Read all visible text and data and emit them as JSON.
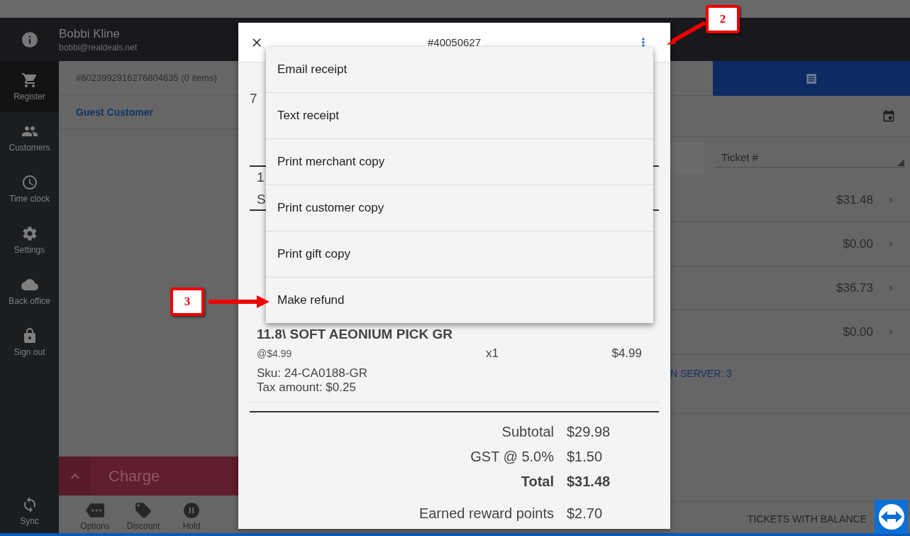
{
  "user": {
    "name": "Bobbi Kline",
    "email": "bobbi@realdeals.net"
  },
  "sidebar": {
    "items": [
      {
        "label": "Register",
        "selected": true
      },
      {
        "label": "Customers",
        "selected": false
      },
      {
        "label": "Time clock",
        "selected": false
      },
      {
        "label": "Settings",
        "selected": false
      },
      {
        "label": "Back office",
        "selected": false
      },
      {
        "label": "Sign out",
        "selected": false
      }
    ],
    "sync": "Sync"
  },
  "ticket": {
    "title": "#6023992916276804635 (0 items)",
    "customer": "Guest Customer",
    "charge": "Charge",
    "actions": [
      {
        "label": "Options"
      },
      {
        "label": "Discount"
      },
      {
        "label": "Hold"
      }
    ]
  },
  "receipts": {
    "filter": {
      "value": "Ticket #"
    },
    "rows": [
      {
        "amount": "$31.48"
      },
      {
        "amount": "$0.00"
      },
      {
        "amount": "$36.73"
      },
      {
        "amount": "$0.00"
      }
    ],
    "server_note": "N SERVER: 3",
    "footer": "TICKETS WITH BALANCE"
  },
  "dialog": {
    "title": "#40050627",
    "fragments": [
      "7",
      "1",
      "S"
    ],
    "item": {
      "name": "11.8\\ SOFT AEONIUM PICK GR",
      "unit_price": "@$4.99",
      "quantity": "x1",
      "price": "$4.99",
      "sku": "Sku: 24-CA0188-GR",
      "tax": "Tax amount: $0.25"
    },
    "totals": [
      {
        "label": "Subtotal",
        "value": "$29.98",
        "kind": "normal"
      },
      {
        "label": "GST @ 5.0%",
        "value": "$1.50",
        "kind": "normal"
      },
      {
        "label": "Total",
        "value": "$31.48",
        "kind": "total"
      },
      {
        "label": "Earned reward points",
        "value": "$2.70",
        "kind": "reward"
      }
    ],
    "menu": [
      {
        "label": "Email receipt"
      },
      {
        "label": "Text receipt"
      },
      {
        "label": "Print merchant copy"
      },
      {
        "label": "Print customer copy"
      },
      {
        "label": "Print gift copy"
      },
      {
        "label": "Make refund"
      }
    ]
  },
  "annotations": [
    {
      "label": "2"
    },
    {
      "label": "3"
    }
  ]
}
